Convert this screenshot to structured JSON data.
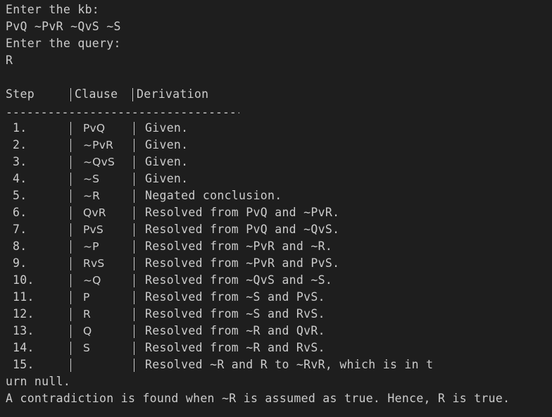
{
  "header": {
    "kb_prompt": "Enter the kb:",
    "kb_input": "PvQ ~PvR ~QvS ~S",
    "query_prompt": "Enter the query:",
    "query_input": "R"
  },
  "table": {
    "headers": {
      "step": "Step",
      "clause": "Clause",
      "derivation": "Derivation"
    },
    "separator": "------------------------------------------------------------------",
    "rows": [
      {
        "step": "1.",
        "clause": "PvQ",
        "derivation": "Given."
      },
      {
        "step": "2.",
        "clause": "~PvR",
        "derivation": "Given."
      },
      {
        "step": "3.",
        "clause": "~QvS",
        "derivation": "Given."
      },
      {
        "step": "4.",
        "clause": "~S",
        "derivation": "Given."
      },
      {
        "step": "5.",
        "clause": "~R",
        "derivation": "Negated conclusion."
      },
      {
        "step": "6.",
        "clause": "QvR",
        "derivation": "Resolved from PvQ and ~PvR."
      },
      {
        "step": "7.",
        "clause": "PvS",
        "derivation": "Resolved from PvQ and ~QvS."
      },
      {
        "step": "8.",
        "clause": "~P",
        "derivation": "Resolved from ~PvR and ~R."
      },
      {
        "step": "9.",
        "clause": "RvS",
        "derivation": "Resolved from ~PvR and PvS."
      },
      {
        "step": "10.",
        "clause": "~Q",
        "derivation": "Resolved from ~QvS and ~S."
      },
      {
        "step": "11.",
        "clause": "P",
        "derivation": "Resolved from ~S and PvS."
      },
      {
        "step": "12.",
        "clause": "R",
        "derivation": "Resolved from ~S and RvS."
      },
      {
        "step": "13.",
        "clause": "Q",
        "derivation": "Resolved from ~R and QvR."
      },
      {
        "step": "14.",
        "clause": "S",
        "derivation": "Resolved from ~R and RvS."
      },
      {
        "step": "15.",
        "clause": "",
        "derivation": "Resolved ~R and R to ~RvR, which is in t"
      }
    ]
  },
  "footer": {
    "wrap_line": "urn null.",
    "conclusion": "A contradiction is found when ~R is assumed as true. Hence, R is true."
  }
}
